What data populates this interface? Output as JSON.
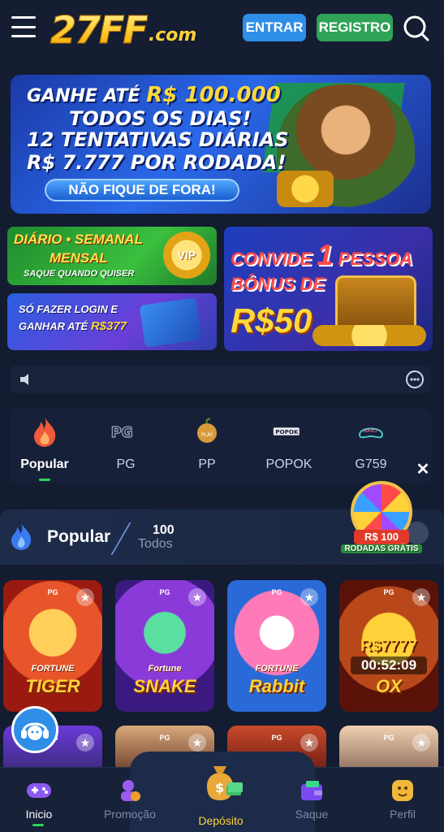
{
  "header": {
    "logo_main": "27FF",
    "logo_sub": ".com",
    "login_label": "ENTRAR",
    "register_label": "REGISTRO"
  },
  "banner_main": {
    "line1_prefix": "GANHE ATÉ",
    "line1_amount": "R$ 100.000",
    "line2": "TODOS OS DIAS!",
    "line3": "12 TENTATIVAS DIÁRIAS",
    "line4": "R$ 7.777 POR RODADA!",
    "cta": "NÃO FIQUE DE FORA!"
  },
  "banner_vip": {
    "line1": "DIÁRIO • SEMANAL",
    "line2": "MENSAL",
    "line3": "SAQUE QUANDO QUISER",
    "badge": "VIP"
  },
  "banner_login": {
    "line1": "SÓ FAZER LOGIN E",
    "line2_prefix": "GANHAR ATÉ",
    "line2_amount": "R$377"
  },
  "banner_invite": {
    "line1_prefix": "CONVIDE",
    "line1_number": "1",
    "line1_suffix": "PESSOA",
    "line2": "BÔNUS DE",
    "line3": "R$50"
  },
  "categories": [
    {
      "label": "Popular",
      "icon": "fire-icon",
      "active": true
    },
    {
      "label": "PG",
      "icon": "pg-logo-icon"
    },
    {
      "label": "PP",
      "icon": "pp-logo-icon"
    },
    {
      "label": "POPOK",
      "icon": "popok-logo-icon"
    },
    {
      "label": "G759",
      "icon": "g759-logo-icon"
    }
  ],
  "section": {
    "title": "Popular",
    "count": "100",
    "sub": "Todos"
  },
  "wheel_promo": {
    "amount": "R$ 100",
    "sub": "RODADAS GRÁTIS"
  },
  "games": [
    {
      "provider": "PG",
      "title_small": "FORTUNE",
      "title": "TIGER"
    },
    {
      "provider": "PG",
      "title_small": "Fortune",
      "title": "SNAKE"
    },
    {
      "provider": "PG",
      "title_small": "FORTUNE",
      "title": "Rabbit"
    },
    {
      "provider": "PG",
      "money": "R$7777",
      "timer": "00:52:09",
      "title": "OX"
    },
    {
      "provider": "PG"
    },
    {
      "provider": "PG"
    },
    {
      "provider": "PG"
    },
    {
      "provider": "PG"
    }
  ],
  "bottom_nav": {
    "items": [
      {
        "label": "Inicio",
        "active": true
      },
      {
        "label": "Promoção"
      },
      {
        "label": "Depósito"
      },
      {
        "label": "Saque"
      },
      {
        "label": "Perfil"
      }
    ]
  },
  "colors": {
    "background": "#131c30",
    "login_button": "#2f8ee8",
    "register_button": "#2fa356",
    "active_indicator": "#2fd45a",
    "deposit_label": "#ffd23a"
  }
}
